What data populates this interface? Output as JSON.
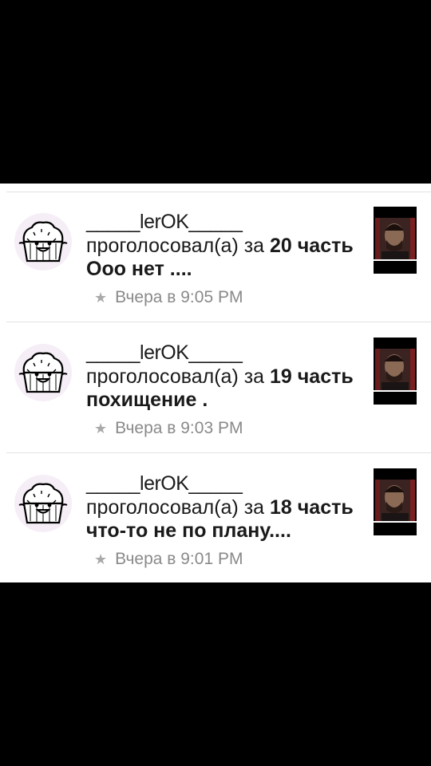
{
  "notifications": [
    {
      "username": "_____lerOK_____",
      "action": "проголосовал(а) за ",
      "part": "20 часть",
      "chapter_title": "Ооо нет ....",
      "time": "Вчера в 9:05 PM"
    },
    {
      "username": "_____lerOK_____",
      "action": "проголосовал(а) за ",
      "part": "19 часть",
      "chapter_title": "похищение .",
      "time": "Вчера в 9:03 PM"
    },
    {
      "username": "_____lerOK_____",
      "action": "проголосовал(а) за ",
      "part": "18 часть",
      "chapter_title": "что-то не по плану....",
      "time": "Вчера в 9:01 PM"
    }
  ],
  "icons": {
    "avatar": "muffin-avatar-icon",
    "meta": "star-icon",
    "cover": "story-cover-thumbnail"
  },
  "colors": {
    "background": "#000000",
    "panel": "#ffffff",
    "text": "#1a1a1a",
    "meta_text": "#8a8a8a",
    "divider": "#e2e2e2"
  }
}
